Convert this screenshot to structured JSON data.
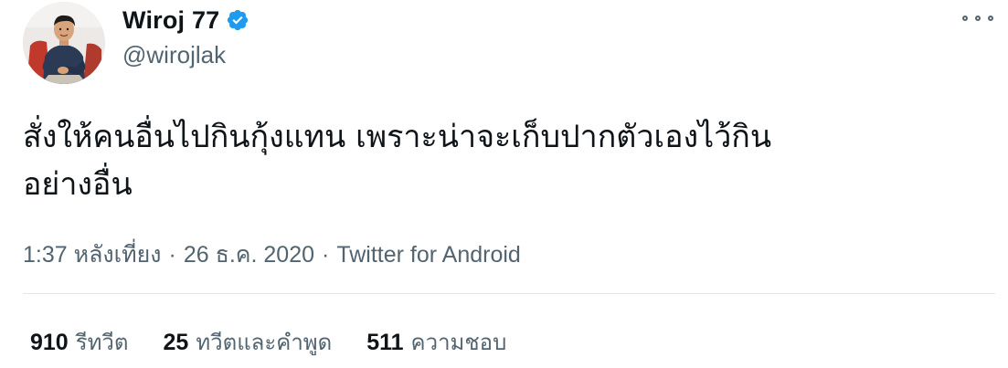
{
  "author": {
    "display_name": "Wiroj 77",
    "handle": "@wirojlak",
    "verified": true,
    "verified_icon": "verified-badge-icon"
  },
  "tweet": {
    "text_line1": "สั่งให้คนอื่นไปกินกุ้งแทน เพราะน่าจะเก็บปากตัวเองไว้กิน",
    "text_line2": "อย่างอื่น",
    "time": "1:37 หลังเที่ยง",
    "date": "26 ธ.ค. 2020",
    "separator": "·",
    "source": "Twitter for Android"
  },
  "stats": {
    "retweets_count": "910",
    "retweets_label": "รีทวีต",
    "quotes_count": "25",
    "quotes_label": "ทวีตและคำพูด",
    "likes_count": "511",
    "likes_label": "ความชอบ"
  },
  "colors": {
    "text_primary": "#0f1419",
    "text_secondary": "#536471",
    "verified_blue": "#1d9bf0",
    "divider": "#e1e8ed"
  }
}
